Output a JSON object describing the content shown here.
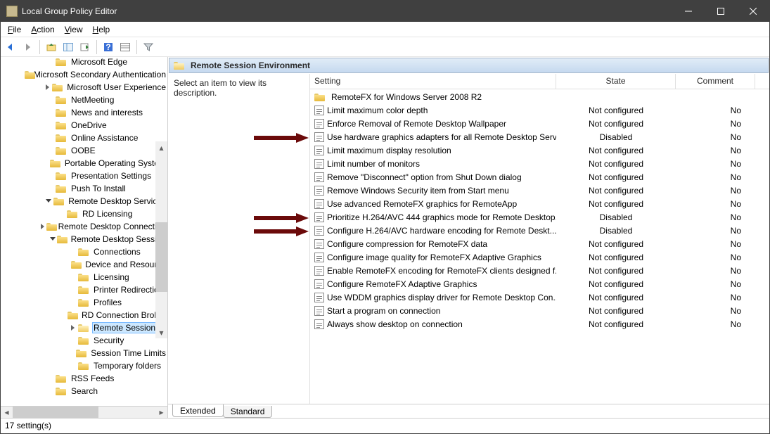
{
  "window": {
    "title": "Local Group Policy Editor",
    "menus": [
      "File",
      "Action",
      "View",
      "Help"
    ]
  },
  "description_hint": "Select an item to view its description.",
  "columns": {
    "setting": "Setting",
    "state": "State",
    "comment": "Comment"
  },
  "header_title": "Remote Session Environment",
  "tabs": {
    "extended": "Extended",
    "standard": "Standard"
  },
  "status": "17 setting(s)",
  "tree": [
    {
      "indent": 4,
      "exp": "",
      "label": "Microsoft Edge"
    },
    {
      "indent": 4,
      "exp": "",
      "label": "Microsoft Secondary Authentication"
    },
    {
      "indent": 4,
      "exp": ">",
      "label": "Microsoft User Experience"
    },
    {
      "indent": 4,
      "exp": "",
      "label": "NetMeeting"
    },
    {
      "indent": 4,
      "exp": "",
      "label": "News and interests"
    },
    {
      "indent": 4,
      "exp": "",
      "label": "OneDrive"
    },
    {
      "indent": 4,
      "exp": "",
      "label": "Online Assistance"
    },
    {
      "indent": 4,
      "exp": "",
      "label": "OOBE"
    },
    {
      "indent": 4,
      "exp": "",
      "label": "Portable Operating System"
    },
    {
      "indent": 4,
      "exp": "",
      "label": "Presentation Settings"
    },
    {
      "indent": 4,
      "exp": "",
      "label": "Push To Install"
    },
    {
      "indent": 4,
      "exp": "v",
      "label": "Remote Desktop Services"
    },
    {
      "indent": 5,
      "exp": "",
      "label": "RD Licensing"
    },
    {
      "indent": 5,
      "exp": ">",
      "label": "Remote Desktop Connection"
    },
    {
      "indent": 5,
      "exp": "v",
      "label": "Remote Desktop Session"
    },
    {
      "indent": 6,
      "exp": "",
      "label": "Connections"
    },
    {
      "indent": 6,
      "exp": "",
      "label": "Device and Resource"
    },
    {
      "indent": 6,
      "exp": "",
      "label": "Licensing"
    },
    {
      "indent": 6,
      "exp": "",
      "label": "Printer Redirection"
    },
    {
      "indent": 6,
      "exp": "",
      "label": "Profiles"
    },
    {
      "indent": 6,
      "exp": "",
      "label": "RD Connection Broker"
    },
    {
      "indent": 6,
      "exp": ">",
      "label": "Remote Session",
      "selected": true,
      "open": true
    },
    {
      "indent": 6,
      "exp": "",
      "label": "Security"
    },
    {
      "indent": 6,
      "exp": "",
      "label": "Session Time Limits"
    },
    {
      "indent": 6,
      "exp": "",
      "label": "Temporary folders"
    },
    {
      "indent": 4,
      "exp": "",
      "label": "RSS Feeds"
    },
    {
      "indent": 4,
      "exp": "",
      "label": "Search"
    }
  ],
  "settings": [
    {
      "type": "folder",
      "name": "RemoteFX for Windows Server 2008 R2",
      "state": "",
      "comment": ""
    },
    {
      "type": "policy",
      "name": "Limit maximum color depth",
      "state": "Not configured",
      "comment": "No"
    },
    {
      "type": "policy",
      "name": "Enforce Removal of Remote Desktop Wallpaper",
      "state": "Not configured",
      "comment": "No"
    },
    {
      "type": "policy",
      "name": "Use hardware graphics adapters for all Remote Desktop Serv...",
      "state": "Disabled",
      "comment": "No",
      "arrow": true
    },
    {
      "type": "policy",
      "name": "Limit maximum display resolution",
      "state": "Not configured",
      "comment": "No"
    },
    {
      "type": "policy",
      "name": "Limit number of monitors",
      "state": "Not configured",
      "comment": "No"
    },
    {
      "type": "policy",
      "name": "Remove \"Disconnect\" option from Shut Down dialog",
      "state": "Not configured",
      "comment": "No"
    },
    {
      "type": "policy",
      "name": "Remove Windows Security item from Start menu",
      "state": "Not configured",
      "comment": "No"
    },
    {
      "type": "policy",
      "name": "Use advanced RemoteFX graphics for RemoteApp",
      "state": "Not configured",
      "comment": "No"
    },
    {
      "type": "policy",
      "name": "Prioritize H.264/AVC 444 graphics mode for Remote Desktop...",
      "state": "Disabled",
      "comment": "No",
      "arrow": true
    },
    {
      "type": "policy",
      "name": "Configure H.264/AVC hardware encoding for Remote Deskt...",
      "state": "Disabled",
      "comment": "No",
      "arrow": true
    },
    {
      "type": "policy",
      "name": "Configure compression for RemoteFX data",
      "state": "Not configured",
      "comment": "No"
    },
    {
      "type": "policy",
      "name": "Configure image quality for RemoteFX Adaptive Graphics",
      "state": "Not configured",
      "comment": "No"
    },
    {
      "type": "policy",
      "name": "Enable RemoteFX encoding for RemoteFX clients designed f...",
      "state": "Not configured",
      "comment": "No"
    },
    {
      "type": "policy",
      "name": "Configure RemoteFX Adaptive Graphics",
      "state": "Not configured",
      "comment": "No"
    },
    {
      "type": "policy",
      "name": "Use WDDM graphics display driver for Remote Desktop Con...",
      "state": "Not configured",
      "comment": "No"
    },
    {
      "type": "policy",
      "name": "Start a program on connection",
      "state": "Not configured",
      "comment": "No"
    },
    {
      "type": "policy",
      "name": "Always show desktop on connection",
      "state": "Not configured",
      "comment": "No"
    }
  ],
  "col_widths": {
    "setting": 350,
    "state": 170,
    "comment": 113
  }
}
